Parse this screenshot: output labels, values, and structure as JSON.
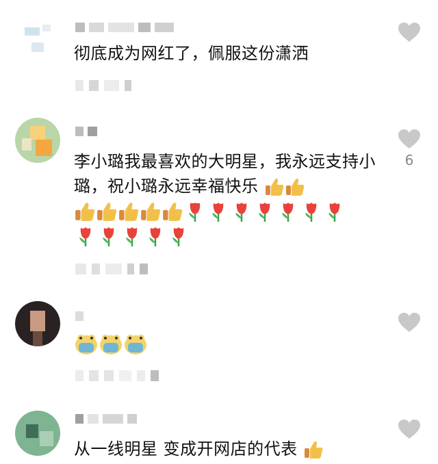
{
  "comments": [
    {
      "text": "彻底成为网红了，佩服这份潇洒",
      "like_count": "",
      "emoji_rows": []
    },
    {
      "text": "李小璐我最喜欢的大明星，我永远支持小璐，祝小璐永远幸福快乐",
      "like_count": "6",
      "emoji_inline": [
        "thumbs-up",
        "thumbs-up"
      ],
      "emoji_rows": [
        [
          "thumbs-up",
          "thumbs-up",
          "thumbs-up",
          "thumbs-up",
          "thumbs-up",
          "tulip",
          "tulip",
          "tulip",
          "tulip",
          "tulip",
          "tulip",
          "tulip"
        ],
        [
          "tulip",
          "tulip",
          "tulip",
          "tulip",
          "tulip"
        ]
      ]
    },
    {
      "text": "",
      "like_count": "",
      "emoji_rows": [
        [
          "masked-frog",
          "masked-frog",
          "masked-frog"
        ]
      ]
    },
    {
      "text": "从一线明星 变成开网店的代表",
      "like_count": "",
      "emoji_inline": [
        "thumbs-up"
      ],
      "emoji_rows": []
    }
  ],
  "colors": {
    "heart": "#c8c8c8",
    "text": "#111111",
    "like_count": "#888888",
    "tulip": "#e8423a",
    "thumb": "#f2c04a",
    "mask": "#6fb6d6"
  }
}
